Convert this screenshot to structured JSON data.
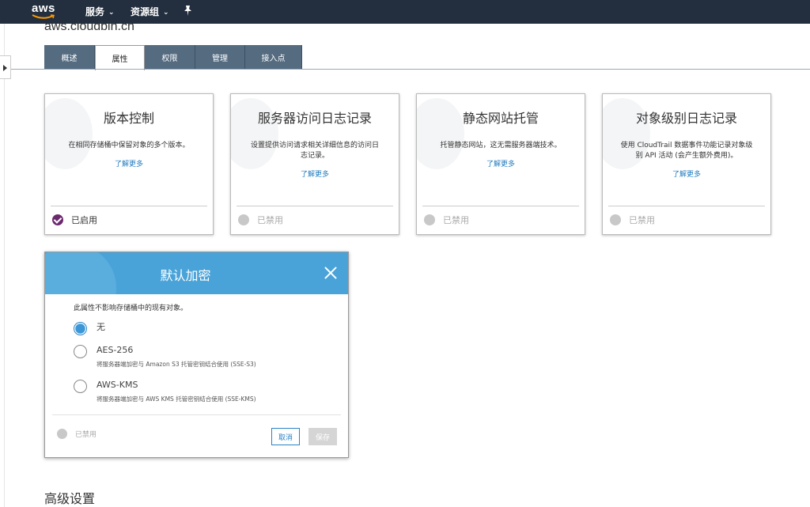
{
  "topnav": {
    "logo_text": "aws",
    "services_label": "服务",
    "resource_groups_label": "资源组"
  },
  "bucket": {
    "title": "aws.cloudbin.cn"
  },
  "tabs": [
    {
      "label": "概述"
    },
    {
      "label": "属性"
    },
    {
      "label": "权限"
    },
    {
      "label": "管理"
    },
    {
      "label": "接入点"
    }
  ],
  "active_tab": "属性",
  "cards": [
    {
      "title": "版本控制",
      "desc": "在相同存储桶中保留对象的多个版本。",
      "link": "了解更多",
      "status": "已启用"
    },
    {
      "title": "服务器访问日志记录",
      "desc": "设置提供访问请求相关详细信息的访问日志记录。",
      "link": "了解更多",
      "status": "已禁用"
    },
    {
      "title": "静态网站托管",
      "desc": "托管静态网站，这无需服务器端技术。",
      "link": "了解更多",
      "status": "已禁用"
    },
    {
      "title": "对象级别日志记录",
      "desc": "使用 CloudTrail 数据事件功能记录对象级别 API 活动 (会产生额外费用)。",
      "link": "了解更多",
      "status": "已禁用"
    }
  ],
  "encryption": {
    "title": "默认加密",
    "note": "此属性不影响存储桶中的现有对象。",
    "options": [
      {
        "label": "无",
        "sub": ""
      },
      {
        "label": "AES-256",
        "sub": "将服务器端加密与 Amazon S3 托管密钥结合使用 (SSE-S3)"
      },
      {
        "label": "AWS-KMS",
        "sub": "将服务器端加密与 AWS KMS 托管密钥结合使用 (SSE-KMS)"
      }
    ],
    "selected": "无",
    "status": "已禁用",
    "cancel_label": "取消",
    "save_label": "保存"
  },
  "advanced": {
    "title": "高级设置"
  },
  "colors": {
    "nav_bg": "#232f3e",
    "tab_bg": "#546b80",
    "dialog_header": "#4aa3d8",
    "link": "#1f7bbf",
    "enabled_check": "#6c2a6e"
  }
}
